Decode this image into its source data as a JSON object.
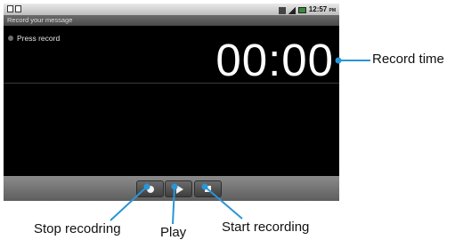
{
  "status_bar": {
    "time": "12:57",
    "meridiem": "PM"
  },
  "app": {
    "title": "Record your message"
  },
  "recorder": {
    "status": "Press record",
    "elapsed": "00:00"
  },
  "annotations": {
    "record_time": "Record time",
    "stop_recording": "Stop recodring",
    "play": "Play",
    "start_recording": "Start recording"
  },
  "colors": {
    "callout": "#2a95d6",
    "screen_bg": "#000000"
  }
}
